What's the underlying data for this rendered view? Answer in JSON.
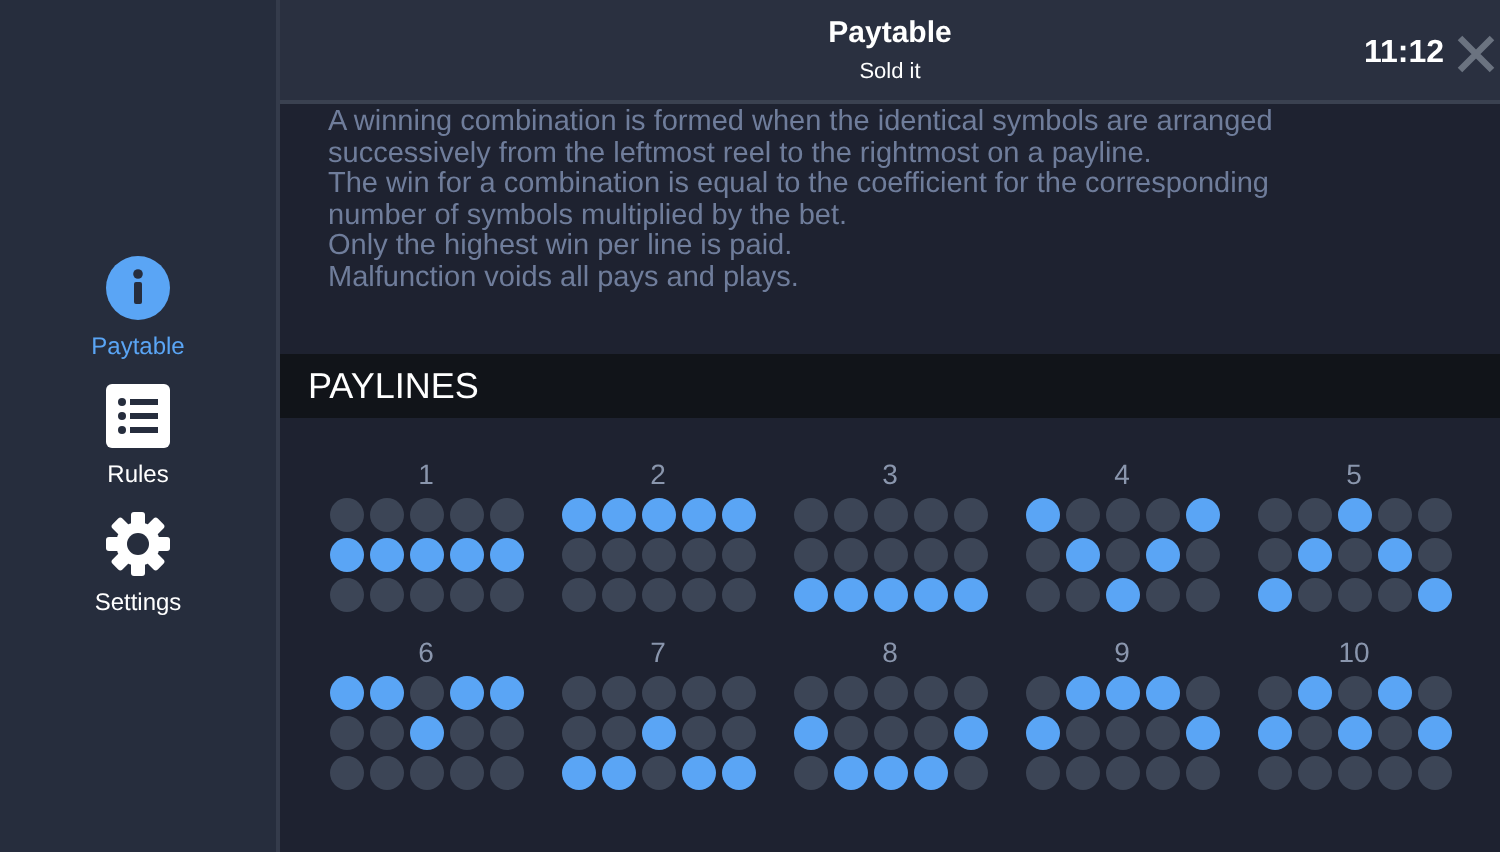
{
  "sidebar": {
    "items": [
      {
        "label": "Paytable",
        "kind": "info",
        "selected": true
      },
      {
        "label": "Rules",
        "kind": "list",
        "selected": false
      },
      {
        "label": "Settings",
        "kind": "gear",
        "selected": false
      }
    ]
  },
  "header": {
    "title": "Paytable",
    "subtitle": "Sold it",
    "time": "11:12"
  },
  "rules_text": [
    "A winning combination is formed when the identical symbols are arranged",
    "successively from the leftmost reel to the rightmost on a payline.",
    "The win for a combination is equal to the coefficient for the corresponding",
    "number of symbols multiplied by the bet.",
    "Only the highest win per line is paid.",
    "Malfunction voids all pays and plays."
  ],
  "paylines": {
    "title": "PAYLINES",
    "lines": [
      {
        "number": "1",
        "rows": [
          [
            false,
            false,
            false,
            false,
            false
          ],
          [
            true,
            true,
            true,
            true,
            true
          ],
          [
            false,
            false,
            false,
            false,
            false
          ]
        ]
      },
      {
        "number": "2",
        "rows": [
          [
            true,
            true,
            true,
            true,
            true
          ],
          [
            false,
            false,
            false,
            false,
            false
          ],
          [
            false,
            false,
            false,
            false,
            false
          ]
        ]
      },
      {
        "number": "3",
        "rows": [
          [
            false,
            false,
            false,
            false,
            false
          ],
          [
            false,
            false,
            false,
            false,
            false
          ],
          [
            true,
            true,
            true,
            true,
            true
          ]
        ]
      },
      {
        "number": "4",
        "rows": [
          [
            true,
            false,
            false,
            false,
            true
          ],
          [
            false,
            true,
            false,
            true,
            false
          ],
          [
            false,
            false,
            true,
            false,
            false
          ]
        ]
      },
      {
        "number": "5",
        "rows": [
          [
            false,
            false,
            true,
            false,
            false
          ],
          [
            false,
            true,
            false,
            true,
            false
          ],
          [
            true,
            false,
            false,
            false,
            true
          ]
        ]
      },
      {
        "number": "6",
        "rows": [
          [
            true,
            true,
            false,
            true,
            true
          ],
          [
            false,
            false,
            true,
            false,
            false
          ],
          [
            false,
            false,
            false,
            false,
            false
          ]
        ]
      },
      {
        "number": "7",
        "rows": [
          [
            false,
            false,
            false,
            false,
            false
          ],
          [
            false,
            false,
            true,
            false,
            false
          ],
          [
            true,
            true,
            false,
            true,
            true
          ]
        ]
      },
      {
        "number": "8",
        "rows": [
          [
            false,
            false,
            false,
            false,
            false
          ],
          [
            true,
            false,
            false,
            false,
            true
          ],
          [
            false,
            true,
            true,
            true,
            false
          ]
        ]
      },
      {
        "number": "9",
        "rows": [
          [
            false,
            true,
            true,
            true,
            false
          ],
          [
            true,
            false,
            false,
            false,
            true
          ],
          [
            false,
            false,
            false,
            false,
            false
          ]
        ]
      },
      {
        "number": "10",
        "rows": [
          [
            false,
            true,
            false,
            true,
            false
          ],
          [
            true,
            false,
            true,
            false,
            true
          ],
          [
            false,
            false,
            false,
            false,
            false
          ]
        ]
      }
    ]
  }
}
